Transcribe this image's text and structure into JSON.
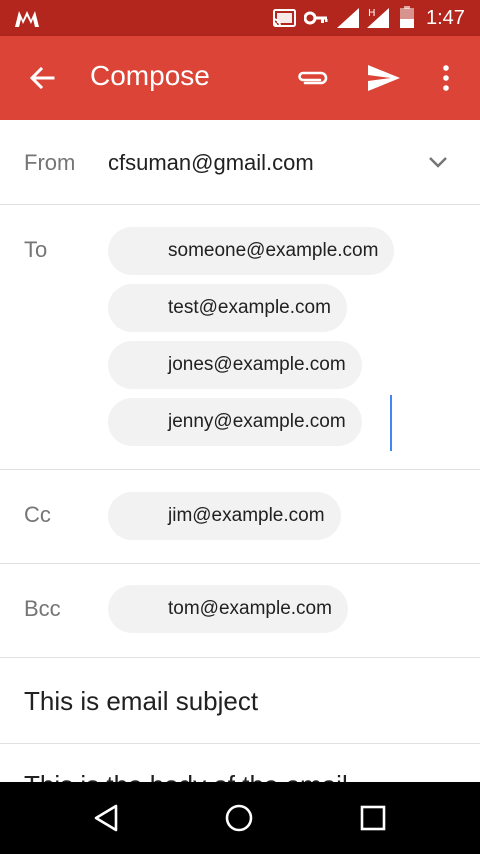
{
  "status_bar": {
    "time": "1:47",
    "icons": [
      "app-logo-icon",
      "cast-icon",
      "key-icon",
      "signal-icon",
      "signal-h-icon",
      "battery-icon"
    ]
  },
  "app_bar": {
    "title": "Compose",
    "icons": [
      "back-arrow-icon",
      "paperclip-icon",
      "send-icon",
      "more-vert-icon"
    ],
    "color": "#db4437"
  },
  "from": {
    "label": "From",
    "value": "cfsuman@gmail.com"
  },
  "to": {
    "label": "To",
    "recipients": [
      "someone@example.com",
      "test@example.com",
      "jones@example.com",
      "jenny@example.com"
    ]
  },
  "cc": {
    "label": "Cc",
    "recipients": [
      "jim@example.com"
    ]
  },
  "bcc": {
    "label": "Bcc",
    "recipients": [
      "tom@example.com"
    ]
  },
  "subject": "This is email subject",
  "body": "This is the body of the email",
  "nav_bar": {
    "icons": [
      "nav-back-icon",
      "nav-home-icon",
      "nav-recents-icon"
    ]
  },
  "colors": {
    "status_bar": "#b3261e",
    "app_bar": "#db4437",
    "chip_bg": "#f2f2f2",
    "cursor": "#4285f4"
  }
}
